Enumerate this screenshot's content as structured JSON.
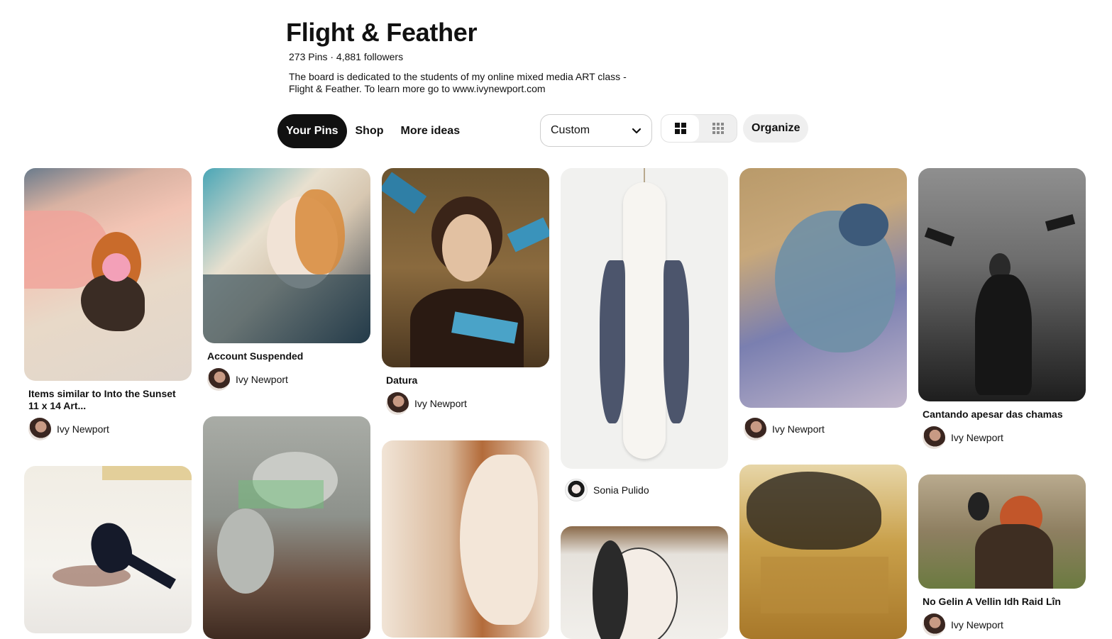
{
  "board": {
    "title": "Flight & Feather",
    "stats": "273 Pins · 4,881 followers",
    "description": "The board is dedicated to the students of my online mixed media ART class - Flight & Feather. To learn more go to www.ivynewport.com"
  },
  "tabs": [
    "Your Pins",
    "Shop",
    "More ideas"
  ],
  "sort": {
    "selected": "Custom"
  },
  "organize_label": "Organize",
  "pins": [
    {
      "caption": "Items similar to Into the Sunset 11 x 14 Art...",
      "author": "Ivy Newport"
    },
    {
      "caption": "Account Suspended",
      "author": "Ivy Newport"
    },
    {
      "caption": "Datura",
      "author": "Ivy Newport"
    },
    {
      "caption": "",
      "author": "Sonia Pulido"
    },
    {
      "caption": "",
      "author": "Ivy Newport"
    },
    {
      "caption": "Cantando apesar das chamas",
      "author": "Ivy Newport"
    },
    {
      "caption": "No Gelin A Vellin Idh Raid Lîn",
      "author": "Ivy Newport"
    }
  ],
  "colors": {
    "active_tab": "#111111",
    "button_bg": "#efefef"
  }
}
